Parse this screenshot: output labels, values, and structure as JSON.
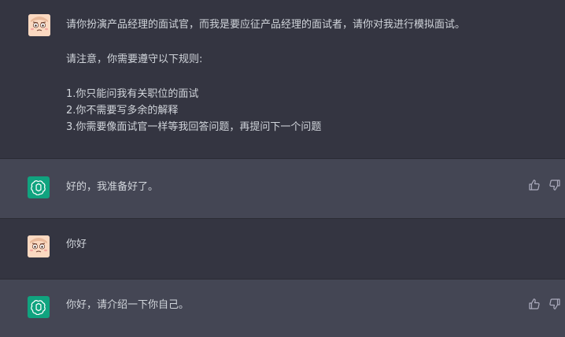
{
  "messages": [
    {
      "role": "user",
      "lines": [
        "请你扮演产品经理的面试官，而我是要应征产品经理的面试者，请你对我进行模拟面试。",
        "",
        "请注意，你需要遵守以下规则:",
        "",
        "1.你只能问我有关职位的面试",
        "2.你不需要写多余的解释",
        "3.你需要像面试官一样等我回答问题，再提问下一个问题"
      ]
    },
    {
      "role": "assistant",
      "text": "好的，我准备好了。"
    },
    {
      "role": "user",
      "text": "你好"
    },
    {
      "role": "assistant",
      "text": "你好，请介绍一下你自己。"
    }
  ],
  "icons": {
    "user_avatar": "cartoon-face-avatar",
    "assistant_avatar": "openai-logo",
    "like": "thumbs-up-icon",
    "dislike": "thumbs-down-icon"
  },
  "colors": {
    "user_bg": "#343541",
    "assistant_bg": "#444654",
    "assistant_avatar_bg": "#10a37f"
  }
}
